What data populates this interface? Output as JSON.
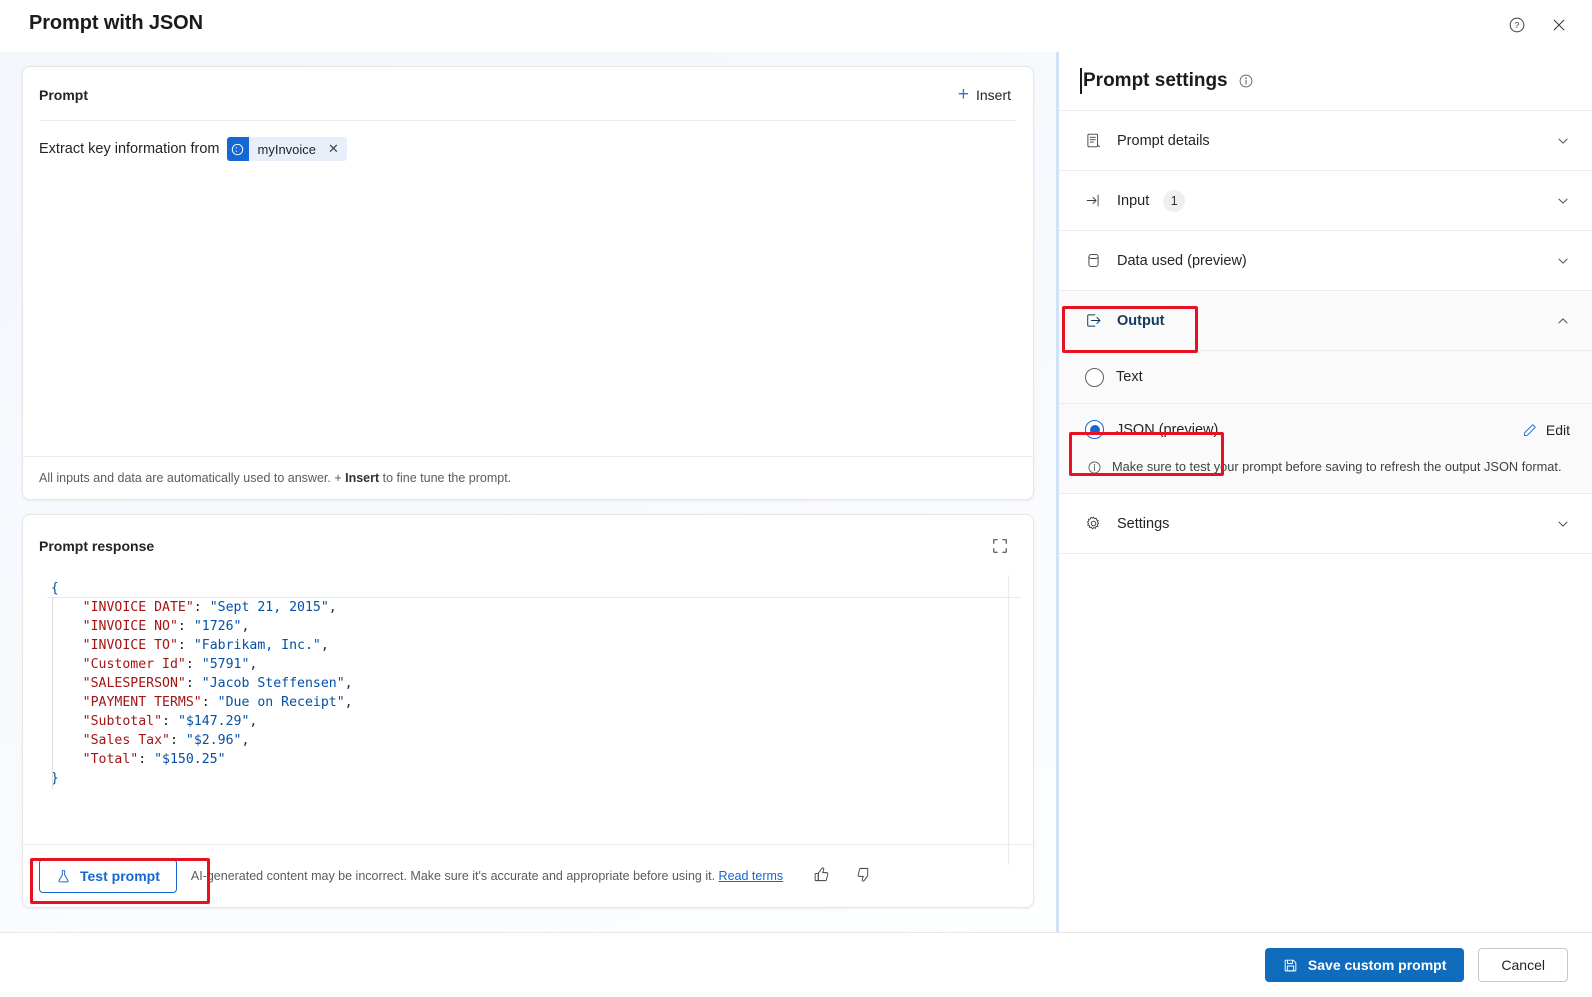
{
  "window": {
    "title": "Prompt with JSON",
    "help_icon": "help-circle-icon",
    "close_icon": "close-icon"
  },
  "prompt_card": {
    "title": "Prompt",
    "insert_label": "Insert",
    "insert_icon": "plus-icon",
    "text_prefix": "Extract key information from",
    "token": {
      "label": "myInvoice",
      "icon": "dataverse-table-icon",
      "remove_icon": "close-icon"
    },
    "footer_before": "All inputs and data are automatically used to answer. + ",
    "footer_bold": "Insert",
    "footer_after": " to fine tune the prompt."
  },
  "response_card": {
    "title": "Prompt response",
    "expand_icon": "expand-icon",
    "code_lines": [
      {
        "indent": 0,
        "segments": [
          {
            "t": "{",
            "c": "br"
          }
        ]
      },
      {
        "indent": 1,
        "segments": [
          {
            "t": "\"INVOICE DATE\"",
            "c": "k"
          },
          {
            "t": ": ",
            "c": "p"
          },
          {
            "t": "\"Sept 21, 2015\"",
            "c": "s"
          },
          {
            "t": ",",
            "c": "p"
          }
        ]
      },
      {
        "indent": 1,
        "segments": [
          {
            "t": "\"INVOICE NO\"",
            "c": "k"
          },
          {
            "t": ": ",
            "c": "p"
          },
          {
            "t": "\"1726\"",
            "c": "s"
          },
          {
            "t": ",",
            "c": "p"
          }
        ]
      },
      {
        "indent": 1,
        "segments": [
          {
            "t": "\"INVOICE TO\"",
            "c": "k"
          },
          {
            "t": ": ",
            "c": "p"
          },
          {
            "t": "\"Fabrikam, Inc.\"",
            "c": "s"
          },
          {
            "t": ",",
            "c": "p"
          }
        ]
      },
      {
        "indent": 1,
        "segments": [
          {
            "t": "\"Customer Id\"",
            "c": "k"
          },
          {
            "t": ": ",
            "c": "p"
          },
          {
            "t": "\"5791\"",
            "c": "s"
          },
          {
            "t": ",",
            "c": "p"
          }
        ]
      },
      {
        "indent": 1,
        "segments": [
          {
            "t": "\"SALESPERSON\"",
            "c": "k"
          },
          {
            "t": ": ",
            "c": "p"
          },
          {
            "t": "\"Jacob Steffensen\"",
            "c": "s"
          },
          {
            "t": ",",
            "c": "p"
          }
        ]
      },
      {
        "indent": 1,
        "segments": [
          {
            "t": "\"PAYMENT TERMS\"",
            "c": "k"
          },
          {
            "t": ": ",
            "c": "p"
          },
          {
            "t": "\"Due on Receipt\"",
            "c": "s"
          },
          {
            "t": ",",
            "c": "p"
          }
        ]
      },
      {
        "indent": 1,
        "segments": [
          {
            "t": "\"Subtotal\"",
            "c": "k"
          },
          {
            "t": ": ",
            "c": "p"
          },
          {
            "t": "\"$147.29\"",
            "c": "s"
          },
          {
            "t": ",",
            "c": "p"
          }
        ]
      },
      {
        "indent": 1,
        "segments": [
          {
            "t": "\"Sales Tax\"",
            "c": "k"
          },
          {
            "t": ": ",
            "c": "p"
          },
          {
            "t": "\"$2.96\"",
            "c": "s"
          },
          {
            "t": ",",
            "c": "p"
          }
        ]
      },
      {
        "indent": 1,
        "segments": [
          {
            "t": "\"Total\"",
            "c": "k"
          },
          {
            "t": ": ",
            "c": "p"
          },
          {
            "t": "\"$150.25\"",
            "c": "s"
          }
        ]
      },
      {
        "indent": 0,
        "segments": [
          {
            "t": "}",
            "c": "br"
          }
        ]
      }
    ],
    "json_values": {
      "INVOICE DATE": "Sept 21, 2015",
      "INVOICE NO": "1726",
      "INVOICE TO": "Fabrikam, Inc.",
      "Customer Id": "5791",
      "SALESPERSON": "Jacob Steffensen",
      "PAYMENT TERMS": "Due on Receipt",
      "Subtotal": "$147.29",
      "Sales Tax": "$2.96",
      "Total": "$150.25"
    },
    "test_button": {
      "label": "Test prompt",
      "icon": "flask-icon"
    },
    "disclaimer_text": "AI-generated content may be incorrect. Make sure it's accurate and appropriate before using it. ",
    "disclaimer_link": "Read terms",
    "thumbs_up_icon": "thumbs-up-icon",
    "thumbs_down_icon": "thumbs-down-icon"
  },
  "settings_pane": {
    "title": "Prompt settings",
    "info_icon": "info-circle-icon",
    "sections": [
      {
        "label": "Prompt details",
        "icon": "document-icon",
        "badge": "",
        "expanded": false
      },
      {
        "label": "Input",
        "icon": "arrow-into-icon",
        "badge": "1",
        "expanded": false
      },
      {
        "label": "Data used (preview)",
        "icon": "database-icon",
        "badge": "",
        "expanded": false
      },
      {
        "label": "Output",
        "icon": "arrow-out-icon",
        "badge": "",
        "expanded": true
      },
      {
        "label": "Settings",
        "icon": "gear-icon",
        "badge": "",
        "expanded": false
      }
    ],
    "output": {
      "options": [
        {
          "label": "Text",
          "selected": false
        },
        {
          "label": "JSON (preview)",
          "selected": true
        }
      ],
      "edit_label": "Edit",
      "edit_icon": "pencil-icon",
      "hint_icon": "info-circle-icon",
      "hint": "Make sure to test your prompt before saving to refresh the output JSON format."
    }
  },
  "footer": {
    "save_label": "Save custom prompt",
    "save_icon": "save-icon",
    "cancel_label": "Cancel"
  },
  "colors": {
    "accent": "#0f6cbd",
    "link": "#1567d3",
    "annotation": "#e81123",
    "json_key": "#a31515",
    "json_string": "#0451a5"
  }
}
